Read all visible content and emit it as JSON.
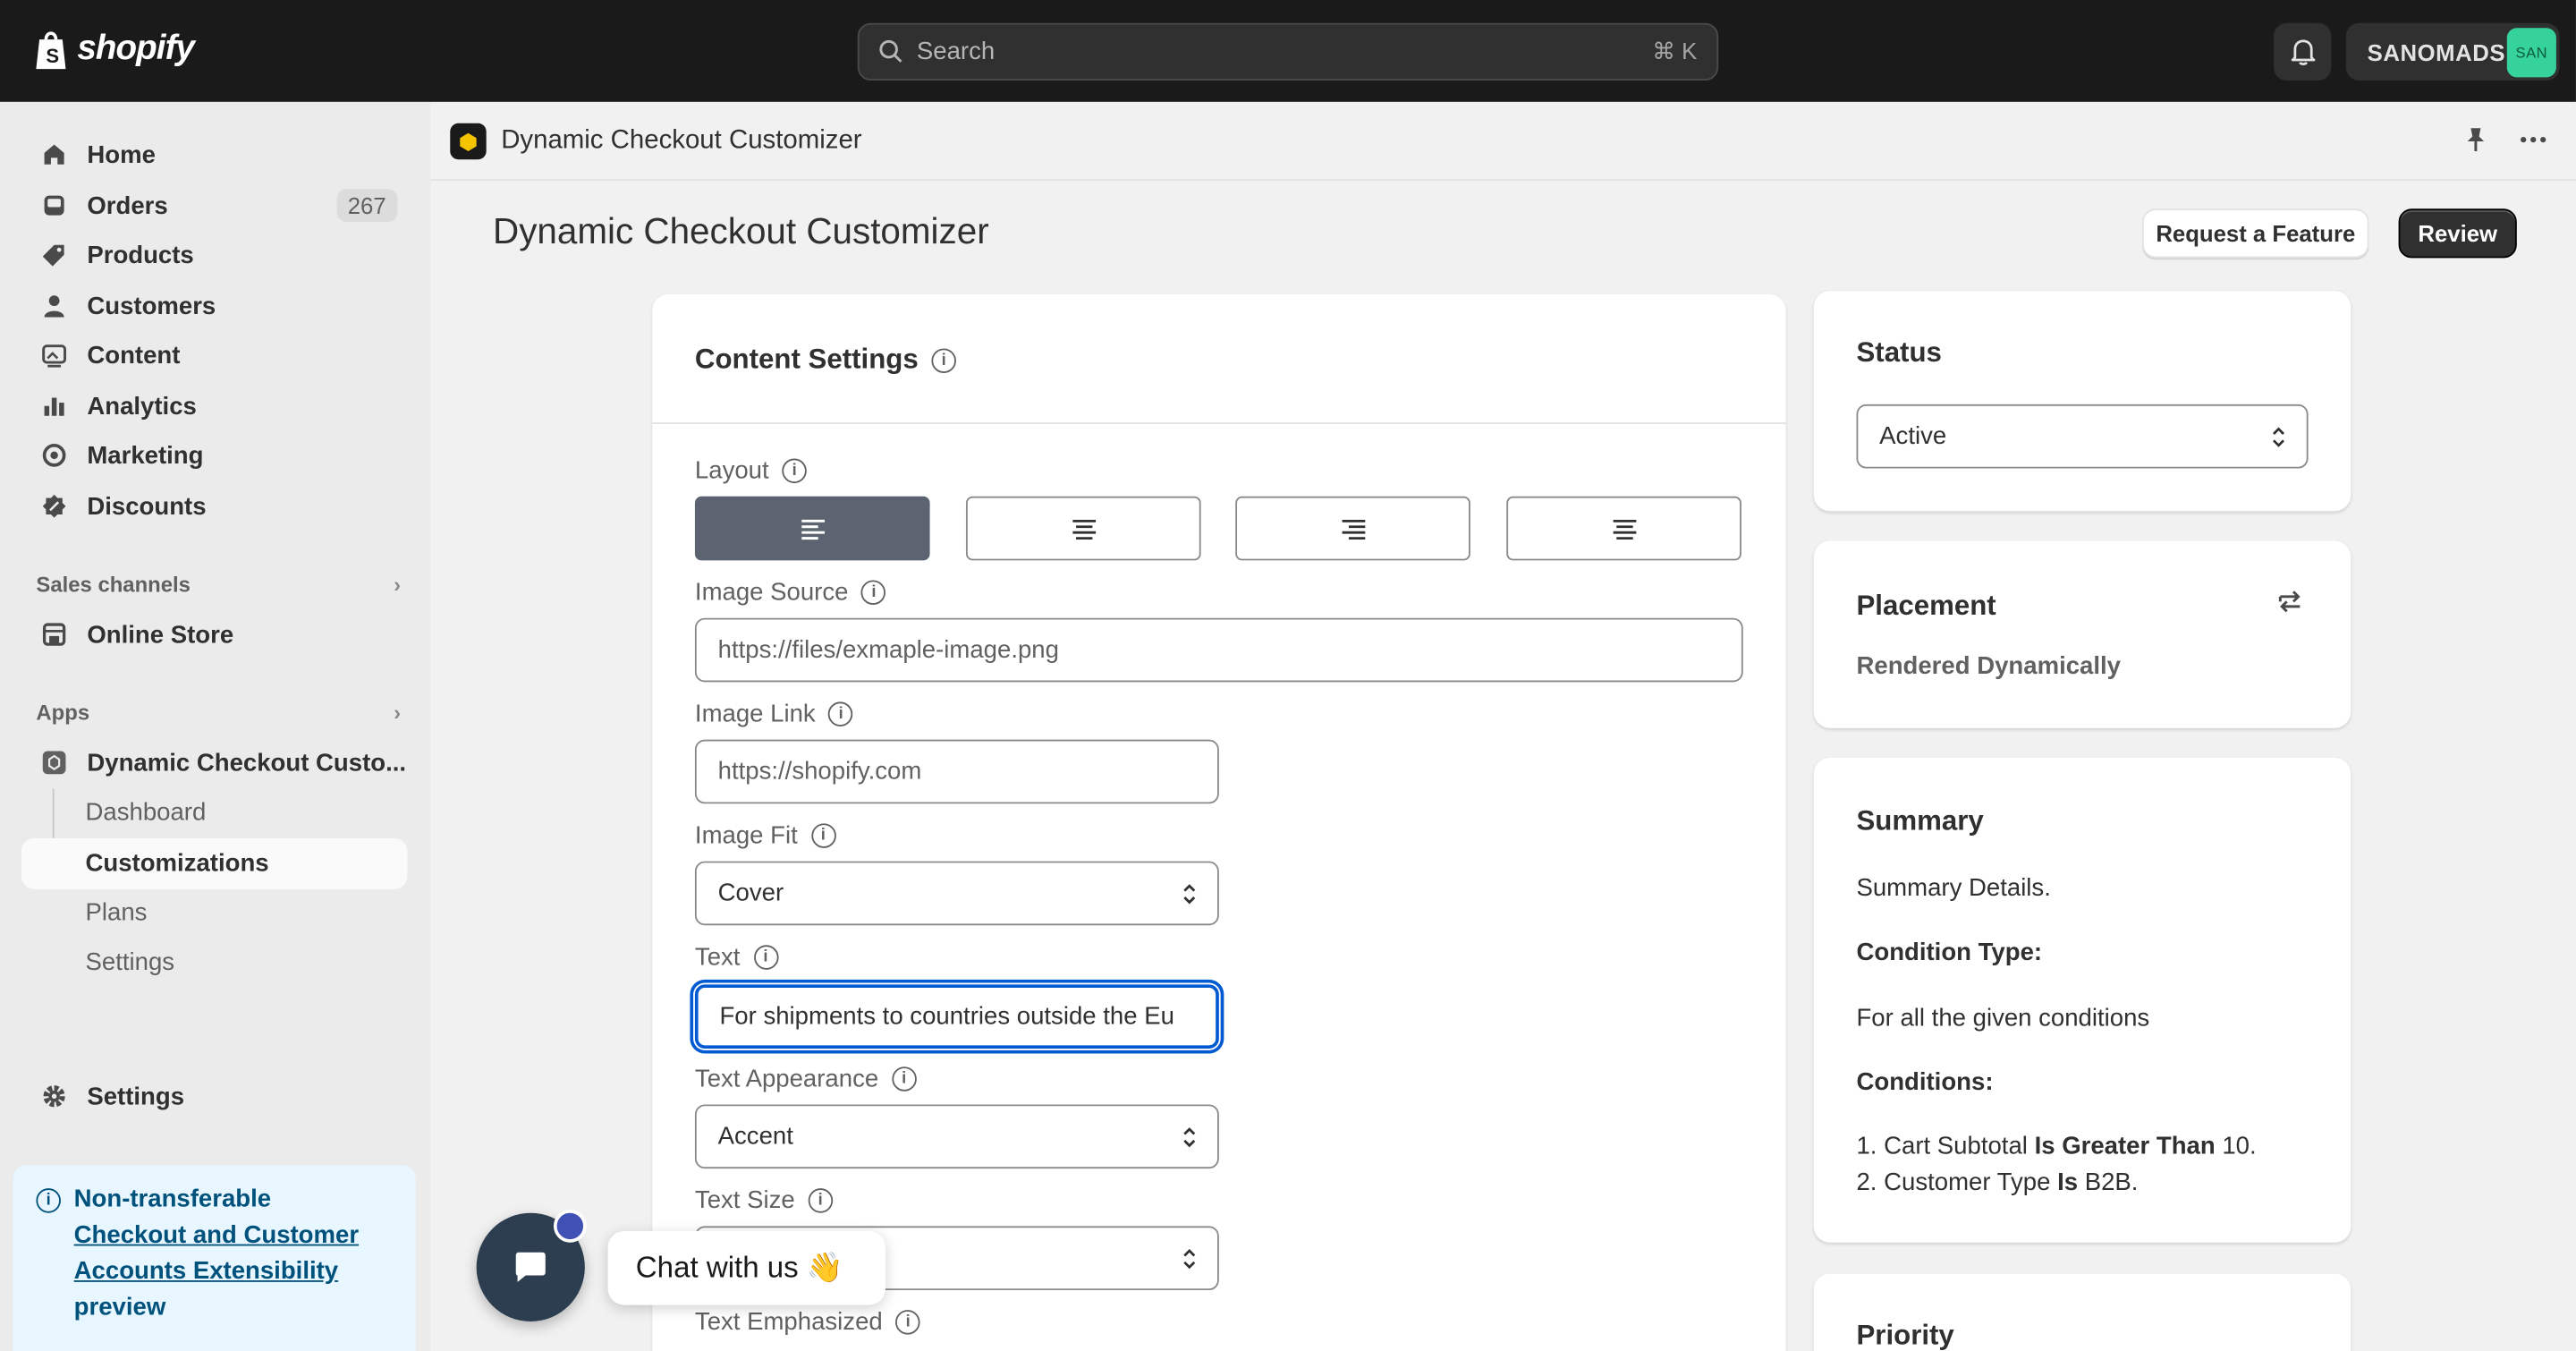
{
  "topbar": {
    "logo_text": "shopify",
    "search_placeholder": "Search",
    "search_shortcut": "⌘ K",
    "store_name": "SANOMADS",
    "store_avatar": "SAN"
  },
  "sidebar": {
    "items": [
      {
        "label": "Home",
        "icon": "home-icon"
      },
      {
        "label": "Orders",
        "icon": "orders-icon",
        "count": "267"
      },
      {
        "label": "Products",
        "icon": "tag-icon"
      },
      {
        "label": "Customers",
        "icon": "person-icon"
      },
      {
        "label": "Content",
        "icon": "image-icon"
      },
      {
        "label": "Analytics",
        "icon": "bar-chart-icon"
      },
      {
        "label": "Marketing",
        "icon": "target-icon"
      },
      {
        "label": "Discounts",
        "icon": "discount-icon"
      }
    ],
    "sales_channels_label": "Sales channels",
    "online_store_label": "Online Store",
    "apps_label": "Apps",
    "app_name": "Dynamic Checkout Custo...",
    "app_subitems": [
      "Dashboard",
      "Customizations",
      "Plans",
      "Settings"
    ],
    "settings_label": "Settings",
    "banner": {
      "line1": "Non-transferable",
      "link": "Checkout and Customer Accounts Extensibility",
      "line3": "preview"
    }
  },
  "app_header": {
    "title": "Dynamic Checkout Customizer"
  },
  "page": {
    "title": "Dynamic Checkout Customizer",
    "request_feature_label": "Request a Feature",
    "review_label": "Review"
  },
  "content_settings": {
    "title": "Content Settings",
    "layout_label": "Layout",
    "image_source_label": "Image Source",
    "image_source_placeholder": "https://files/exmaple-image.png",
    "image_link_label": "Image Link",
    "image_link_placeholder": "https://shopify.com",
    "image_fit_label": "Image Fit",
    "image_fit_value": "Cover",
    "text_label": "Text",
    "text_value": "For shipments to countries outside the Eu",
    "text_appearance_label": "Text Appearance",
    "text_appearance_value": "Accent",
    "text_size_label": "Text Size",
    "text_emphasized_label": "Text Emphasized"
  },
  "status": {
    "title": "Status",
    "value": "Active"
  },
  "placement": {
    "title": "Placement",
    "value": "Rendered Dynamically"
  },
  "summary": {
    "title": "Summary",
    "details": "Summary Details.",
    "condition_type_label": "Condition Type:",
    "condition_type_value": "For all the given conditions",
    "conditions_label": "Conditions:",
    "condition1": {
      "prefix": "1. Cart Subtotal ",
      "op": "Is Greater Than",
      "value": " 10."
    },
    "condition2": {
      "prefix": "2. Customer Type ",
      "op": "Is",
      "value": " B2B."
    }
  },
  "priority": {
    "title": "Priority"
  },
  "chat": {
    "label": "Chat with us 👋"
  },
  "colors": {
    "accent_blue": "#005bd3",
    "topbar": "#1a1a1a",
    "avatar_green": "#36d29b"
  }
}
